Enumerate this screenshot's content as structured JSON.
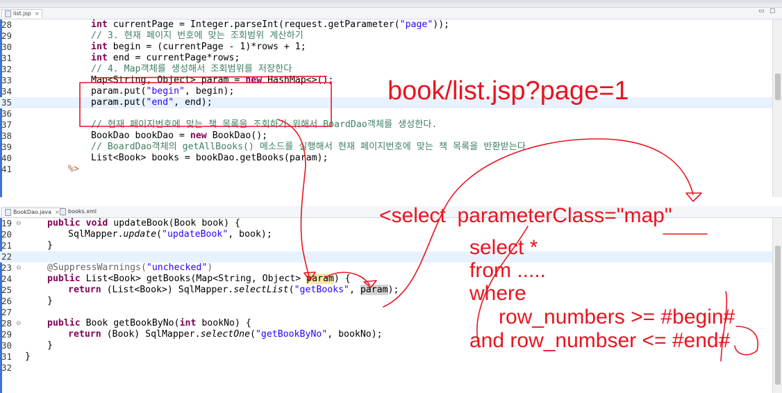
{
  "top_editor": {
    "tab_label": "list.jsp",
    "lines": [
      {
        "num": "28"
      },
      {
        "num": "29"
      },
      {
        "num": "30"
      },
      {
        "num": "31"
      },
      {
        "num": "32"
      },
      {
        "num": "33"
      },
      {
        "num": "34"
      },
      {
        "num": "35"
      },
      {
        "num": "36"
      },
      {
        "num": "37"
      },
      {
        "num": "38"
      },
      {
        "num": "39"
      },
      {
        "num": "40"
      },
      {
        "num": "41"
      }
    ],
    "code": {
      "l28_a": "int",
      "l28_b": " currentPage = Integer.parseInt(request.getParameter(",
      "l28_c": "\"page\"",
      "l28_d": "));",
      "l29": "// 3. 현재 페이지 번호에 맞는 조회범위 계산하기",
      "l30_a": "int",
      "l30_b": " begin = (currentPage - 1)*rows + 1;",
      "l31_a": "int",
      "l31_b": " end = currentPage*rows;",
      "l32": "// 4. Map객체를 생성해서 조회범위를 저장한다",
      "l33_a": "Map<String, Object> param = ",
      "l33_b": "new",
      "l33_c": " HashMap<>();",
      "l34_a": "param.put(",
      "l34_b": "\"begin\"",
      "l34_c": ", begin);",
      "l35_a": "param.put(",
      "l35_b": "\"end\"",
      "l35_c": ", end);",
      "l37": "// 현재 페이지번호에 맞는 책 목록을 조회하기 위해서 BoardDao객체를 생성한다.",
      "l38_a": "BookDao bookDao = ",
      "l38_b": "new",
      "l38_c": " BookDao();",
      "l39": "// BoardDao객체의 getAllBooks() 메소드를 실행해서 현재 페이지번호에 맞는 책 목록을 반환받는다.",
      "l40": "List<Book> books = bookDao.getBooks(param);",
      "l41": "%>"
    }
  },
  "bottom_editor": {
    "tabs": [
      {
        "label": "BookDao.java"
      },
      {
        "label": "books.xml"
      }
    ],
    "lines": [
      {
        "num": "19"
      },
      {
        "num": "20"
      },
      {
        "num": "21"
      },
      {
        "num": "22"
      },
      {
        "num": "23"
      },
      {
        "num": "24"
      },
      {
        "num": "25"
      },
      {
        "num": "26"
      },
      {
        "num": "27"
      },
      {
        "num": "28"
      },
      {
        "num": "29"
      },
      {
        "num": "30"
      },
      {
        "num": "31"
      },
      {
        "num": "32"
      }
    ],
    "code": {
      "l19_a": "public void",
      "l19_b": " updateBook(Book book) {",
      "l20_a": "SqlMapper.",
      "l20_b": "update",
      "l20_c": "(",
      "l20_d": "\"updateBook\"",
      "l20_e": ", book);",
      "l21": "}",
      "l23_a": "@SuppressWarnings(",
      "l23_b": "\"unchecked\"",
      "l23_c": ")",
      "l24_a": "public",
      "l24_b": " List<Book> getBooks(Map<String, Object> ",
      "l24_c": "param",
      "l24_d": ") {",
      "l25_a": "return",
      "l25_b": " (List<Book>) SqlMapper.",
      "l25_c": "selectList",
      "l25_d": "(",
      "l25_e": "\"getBooks\"",
      "l25_f": ", ",
      "l25_g": "param",
      "l25_h": ");",
      "l26": "}",
      "l28_a": "public",
      "l28_b": " Book getBookByNo(",
      "l28_c": "int",
      "l28_d": " bookNo) {",
      "l29_a": "return",
      "l29_b": " (Book) SqlMapper.",
      "l29_c": "selectOne",
      "l29_d": "(",
      "l29_e": "\"getBookByNo\"",
      "l29_f": ", bookNo);",
      "l30": "}",
      "l31": "}"
    }
  },
  "handwriting": {
    "url_note": "book/list.jsp?page=1",
    "select_clause": "<select  parameterClass=\"map\"",
    "sql_select": "select *",
    "sql_from": "from .....",
    "sql_where": "where",
    "sql_cond1": "row_numbers >= #begin#",
    "sql_cond2": "and row_numbser <= #end#"
  },
  "colors": {
    "keyword": "#7f0055",
    "string": "#2a00ff",
    "comment": "#3f7f5f",
    "ink": "#e8141f",
    "line_highlight": "#e8f2fe"
  }
}
